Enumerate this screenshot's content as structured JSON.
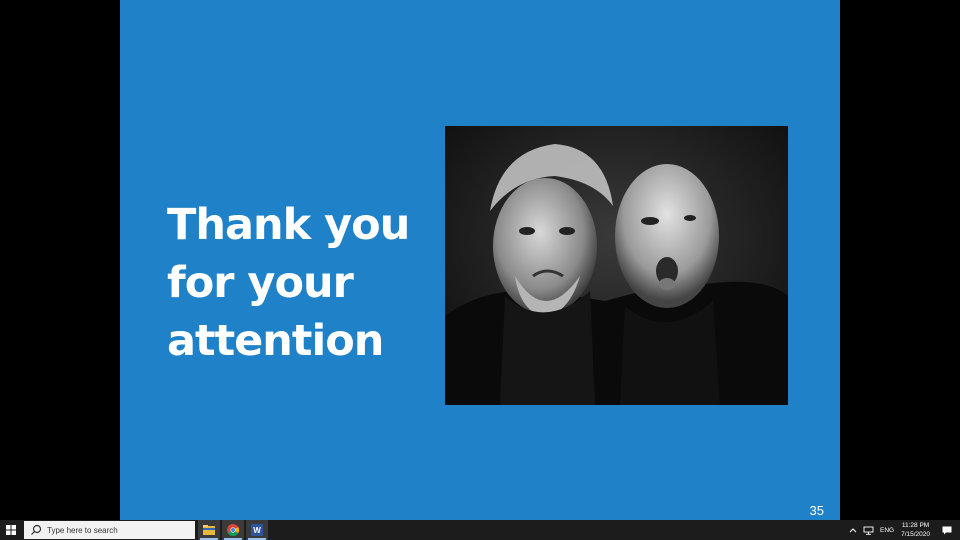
{
  "slide": {
    "title_lines": [
      "Thank you",
      "for your",
      "attention"
    ],
    "page_number": "35",
    "background_color": "#1f82c8"
  },
  "taskbar": {
    "search_placeholder": "Type here to search",
    "apps": [
      "file-explorer-icon",
      "chrome-icon",
      "word-icon"
    ],
    "tray": {
      "language": "ENG",
      "time": "11:28 PM",
      "date": "7/15/2020"
    }
  }
}
